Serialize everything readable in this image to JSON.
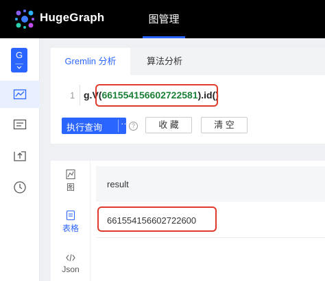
{
  "app": {
    "name": "HugeGraph"
  },
  "topnav": {
    "item": "图管理"
  },
  "sidebar": {
    "graph_initial": "G"
  },
  "query": {
    "tabs": [
      "Gremlin 分析",
      "算法分析"
    ],
    "line_number": "1",
    "code_prefix": "g.V(",
    "code_id": "661554156602722581",
    "code_suffix": ").id()",
    "execute_label": "执行查询",
    "more_label": "···",
    "help_label": "?",
    "favorite_label": "收 藏",
    "clear_label": "清 空"
  },
  "result": {
    "views": [
      {
        "label": "图",
        "icon": "graph-view-icon"
      },
      {
        "label": "表格",
        "icon": "table-view-icon"
      },
      {
        "label": "Json",
        "icon": "code-view-icon"
      }
    ],
    "column_header": "result",
    "rows": [
      "661554156602722600"
    ]
  },
  "colors": {
    "accent": "#2b65ff",
    "highlight": "#e0392b",
    "number": "#1a7f37"
  }
}
